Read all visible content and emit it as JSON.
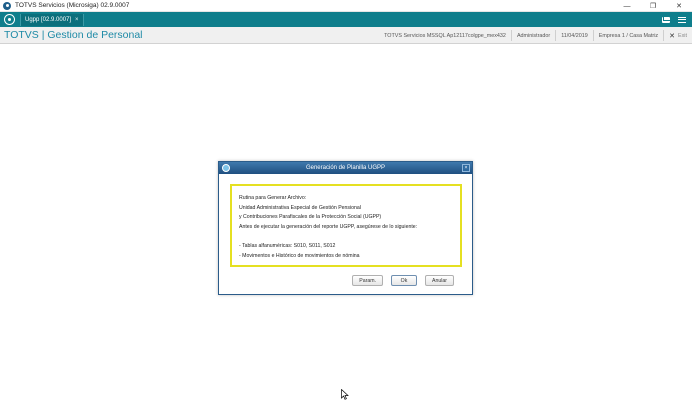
{
  "window": {
    "title": "TOTVS Servicios (Microsiga) 02.9.0007",
    "controls": [
      "—",
      "❐",
      "✕"
    ]
  },
  "tabs": [
    {
      "label": "Ugpp [02.9.0007]",
      "close": "×"
    }
  ],
  "header": {
    "app_title": "TOTVS | Gestion de Personal",
    "server": "TOTVS Servicios MSSQL Ap12117colgpe_mex432",
    "user": "Administrador",
    "date": "11/04/2019",
    "company": "Empresa 1 / Casa Matriz",
    "exit_label": "Exit"
  },
  "dialog": {
    "title": "Generación de Planilla UGPP",
    "close": "×",
    "message_lines": [
      "Rutina para Generar Archivo:",
      "Unidad Administrativa Especial de Gestión Pensional",
      "y Contribuciones Parafiscales de la Protección Social (UGPP)",
      "Antes de ejecutar la generación del reporte UGPP, asegúrese de lo siguiente:",
      "",
      "- Tablas alfanuméricas: S010, S011, S012",
      "- Movimentos e Histórico de movimientos de nómina"
    ],
    "buttons": {
      "params": "Param.",
      "ok": "Ok",
      "cancel": "Anular"
    }
  },
  "colors": {
    "tabbar": "#0f7e8c",
    "app_title": "#1e8aa6",
    "dialog_titlebar": "#1f4f80",
    "highlight_border": "#e5e021"
  }
}
